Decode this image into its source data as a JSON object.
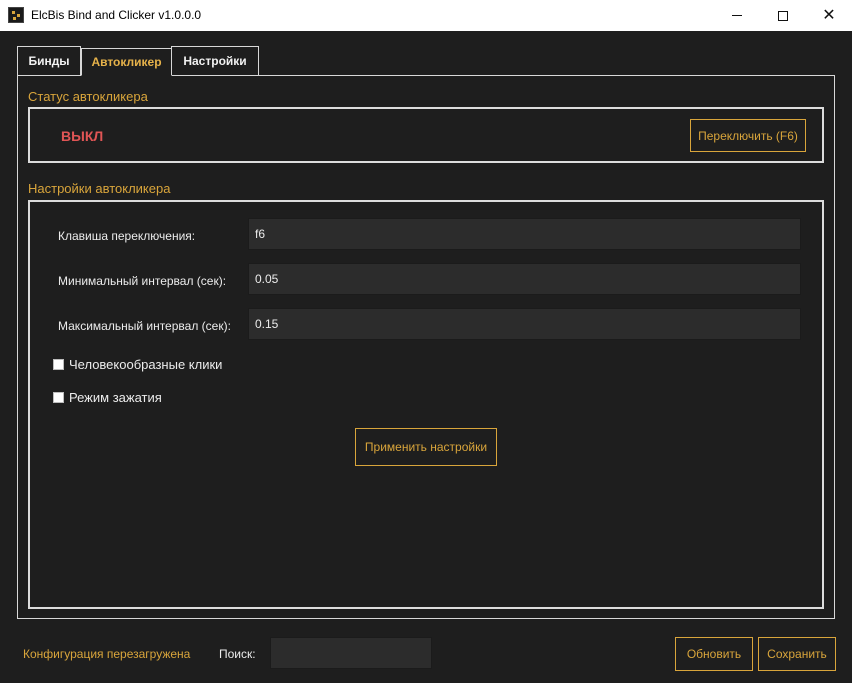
{
  "window": {
    "title": "ElcBis Bind and Clicker v1.0.0.0",
    "controls": {
      "minimize": "minimize-icon",
      "maximize": "maximize-icon",
      "close": "close-icon"
    }
  },
  "tabs": [
    {
      "label": "Бинды",
      "active": false
    },
    {
      "label": "Автокликер",
      "active": true
    },
    {
      "label": "Настройки",
      "active": false
    }
  ],
  "status_section": {
    "title": "Статус автокликера",
    "value": "ВЫКЛ",
    "toggle_button": "Переключить (F6)"
  },
  "settings_section": {
    "title": "Настройки автокликера",
    "fields": [
      {
        "label": "Клавиша переключения:",
        "value": "f6"
      },
      {
        "label": "Минимальный интервал (сек):",
        "value": "0.05"
      },
      {
        "label": "Максимальный интервал (сек):",
        "value": "0.15"
      }
    ],
    "checkboxes": [
      {
        "label": "Человекообразные клики",
        "checked": false
      },
      {
        "label": "Режим зажатия",
        "checked": false
      }
    ],
    "apply_button": "Применить настройки"
  },
  "footer": {
    "status": "Конфигурация перезагружена",
    "search_label": "Поиск:",
    "search_value": "",
    "refresh_button": "Обновить",
    "save_button": "Сохранить"
  },
  "colors": {
    "accent": "#d9a53b",
    "status_off": "#e05555",
    "background": "#1e1e1e",
    "input_bg": "#2c2c2c"
  }
}
